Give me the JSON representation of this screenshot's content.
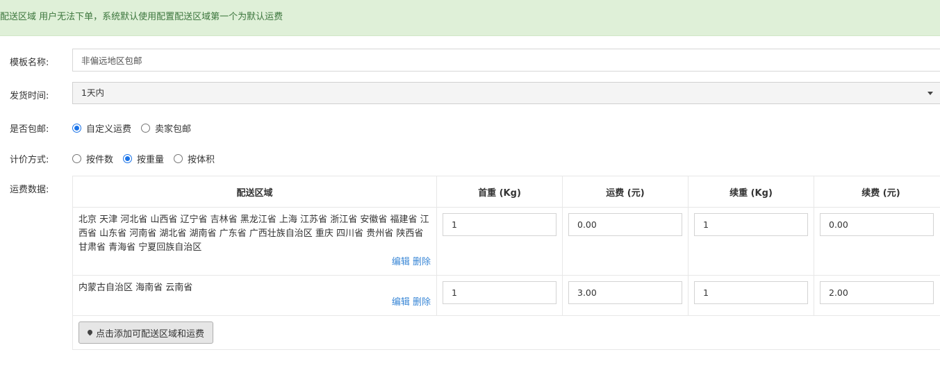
{
  "notice": {
    "text": "配送区域 用户无法下单，系统默认使用配置配送区域第一个为默认运费"
  },
  "form": {
    "template_name": {
      "label": "模板名称:",
      "value": "非偏远地区包邮"
    },
    "ship_time": {
      "label": "发货时间:",
      "value": "1天内"
    },
    "free_shipping": {
      "label": "是否包邮:",
      "options": [
        {
          "label": "自定义运费",
          "checked": true
        },
        {
          "label": "卖家包邮",
          "checked": false
        }
      ]
    },
    "pricing": {
      "label": "计价方式:",
      "options": [
        {
          "label": "按件数",
          "checked": false
        },
        {
          "label": "按重量",
          "checked": true
        },
        {
          "label": "按体积",
          "checked": false
        }
      ]
    },
    "fee_data_label": "运费数据:"
  },
  "table": {
    "headers": [
      "配送区域",
      "首重 (Kg)",
      "运费 (元)",
      "续重 (Kg)",
      "续费 (元)"
    ],
    "rows": [
      {
        "region": "北京 天津 河北省 山西省 辽宁省 吉林省 黑龙江省 上海 江苏省 浙江省 安徽省 福建省 江西省 山东省 河南省 湖北省 湖南省 广东省 广西壮族自治区 重庆 四川省 贵州省 陕西省 甘肃省 青海省 宁夏回族自治区",
        "first_weight": "1",
        "fee": "0.00",
        "extra_weight": "1",
        "extra_fee": "0.00"
      },
      {
        "region": "内蒙古自治区 海南省 云南省",
        "first_weight": "1",
        "fee": "3.00",
        "extra_weight": "1",
        "extra_fee": "2.00"
      }
    ],
    "edit_label": "编辑",
    "delete_label": "删除",
    "add_button_label": "点击添加可配送区域和运费"
  }
}
